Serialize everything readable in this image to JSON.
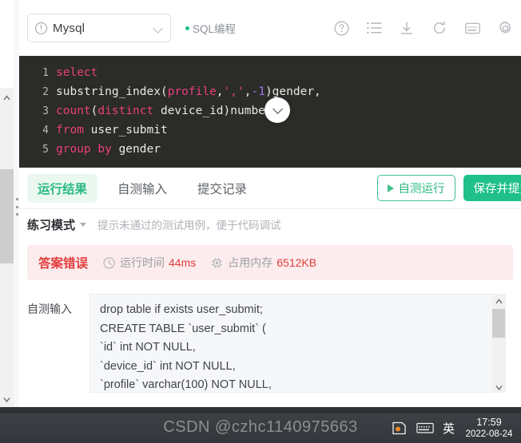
{
  "header": {
    "db_select": {
      "value": "Mysql",
      "icon": "info-circle-icon",
      "caret": "chevron-down-icon"
    },
    "sql_tag": "SQL编程",
    "tools": [
      {
        "name": "help-icon",
        "label": "?"
      },
      {
        "name": "list-icon",
        "label": "list"
      },
      {
        "name": "download-icon",
        "label": "download"
      },
      {
        "name": "refresh-icon",
        "label": "refresh"
      },
      {
        "name": "keyboard-icon",
        "label": "keyboard"
      },
      {
        "name": "settings-gear-icon",
        "label": "settings"
      }
    ]
  },
  "editor": {
    "lines": [
      {
        "no": "1",
        "segments": [
          {
            "t": "select",
            "c": "kw"
          }
        ]
      },
      {
        "no": "2",
        "segments": [
          {
            "t": "substring_index(",
            "c": ""
          },
          {
            "t": "profile",
            "c": "id-pink"
          },
          {
            "t": ",",
            "c": ""
          },
          {
            "t": "','",
            "c": "str"
          },
          {
            "t": ",",
            "c": ""
          },
          {
            "t": "-1",
            "c": "num"
          },
          {
            "t": ")gender,",
            "c": ""
          }
        ]
      },
      {
        "no": "3",
        "segments": [
          {
            "t": "count",
            "c": "kw"
          },
          {
            "t": "(",
            "c": ""
          },
          {
            "t": "distinct",
            "c": "kw"
          },
          {
            "t": " device_id)number",
            "c": ""
          }
        ]
      },
      {
        "no": "4",
        "segments": [
          {
            "t": "from",
            "c": "kw"
          },
          {
            "t": " user_submit",
            "c": ""
          }
        ]
      },
      {
        "no": "5",
        "segments": [
          {
            "t": "group by",
            "c": "kw"
          },
          {
            "t": " gender",
            "c": ""
          }
        ]
      }
    ],
    "collapse_icon": "chevron-down-icon"
  },
  "tabs": [
    {
      "label": "运行结果",
      "active": true
    },
    {
      "label": "自测输入",
      "active": false
    },
    {
      "label": "提交记录",
      "active": false
    }
  ],
  "actions": {
    "run_label": "自测运行",
    "submit_label": "保存并提交"
  },
  "mode": {
    "name": "练习模式",
    "hint": "提示未通过的测试用例，便于代码调试"
  },
  "result": {
    "verdict": "答案错误",
    "time_label": "运行时间",
    "time_value": "44ms",
    "mem_label": "占用内存",
    "mem_value": "6512KB"
  },
  "test_input": {
    "label": "自测输入",
    "text": "drop table if exists user_submit;\nCREATE TABLE `user_submit` (\n`id` int NOT NULL,\n`device_id` int NOT NULL,\n`profile` varchar(100) NOT NULL,"
  },
  "taskbar": {
    "ime": "英",
    "time": "17:59",
    "date": "2022-08-24",
    "watermark": "CSDN @czhc1140975663"
  },
  "colors": {
    "accent_green": "#1fc08a",
    "error_red": "#e13c3c",
    "editor_bg": "#2b2b28",
    "keyword_pink": "#e8407a"
  }
}
